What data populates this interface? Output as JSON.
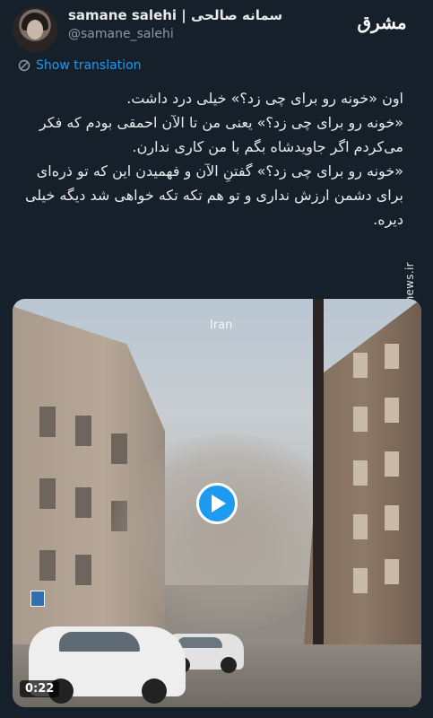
{
  "author": {
    "display_name": "samane salehi | سمانه صالحی",
    "handle": "@samane_salehi"
  },
  "brand": {
    "logo_text": "مشرق",
    "watermark": "mashreghnews.ir"
  },
  "actions": {
    "show_translation": "Show translation"
  },
  "tweet": {
    "paragraphs": [
      "اون «خونه رو برای چی زد؟» خیلی درد داشت.",
      "«خونه رو برای چی زد؟» یعنی من تا الآن احمقی بودم که فکر می‌کردم اگر جاویدشاه بگم با من کاری ندارن.",
      "«خونه رو برای چی زد؟» گفتنِ الآن و فهمیدن این که تو ذره‌ای برای دشمن ارزش نداری و تو هم تکه تکه خواهی شد دیگه خیلی دیره."
    ]
  },
  "media": {
    "overlay_label": "Iran",
    "duration": "0:22",
    "play_icon": "play-icon",
    "accent_color": "#1d9bf0"
  }
}
